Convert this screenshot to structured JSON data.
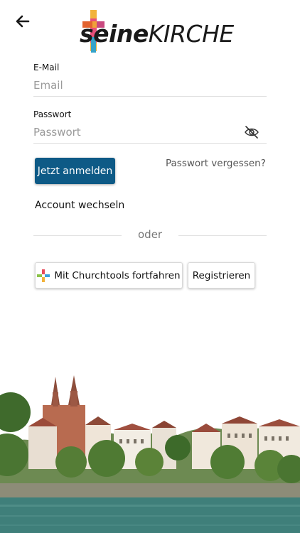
{
  "header": {
    "back_icon": "arrow-left-icon",
    "logo": {
      "part_bold": "seine",
      "part_light": "KIRCHE",
      "icon": "cross-icon"
    }
  },
  "form": {
    "email": {
      "label": "E-Mail",
      "placeholder": "Email",
      "value": ""
    },
    "password": {
      "label": "Passwort",
      "placeholder": "Passwort",
      "value": "",
      "toggle_icon": "eye-off-icon"
    },
    "login_button": "Jetzt anmelden",
    "forgot_link": "Passwort vergessen?",
    "account_switch": "Account wechseln",
    "divider_text": "oder"
  },
  "alt_actions": {
    "churchtools_button": "Mit Churchtools fortfahren",
    "churchtools_icon": "churchtools-icon",
    "register_button": "Registrieren"
  },
  "colors": {
    "primary": "#0e5a86",
    "water": "#3f7f7a",
    "sky": "#ffffff"
  },
  "footer_image": "basel-riverside-cityscape"
}
